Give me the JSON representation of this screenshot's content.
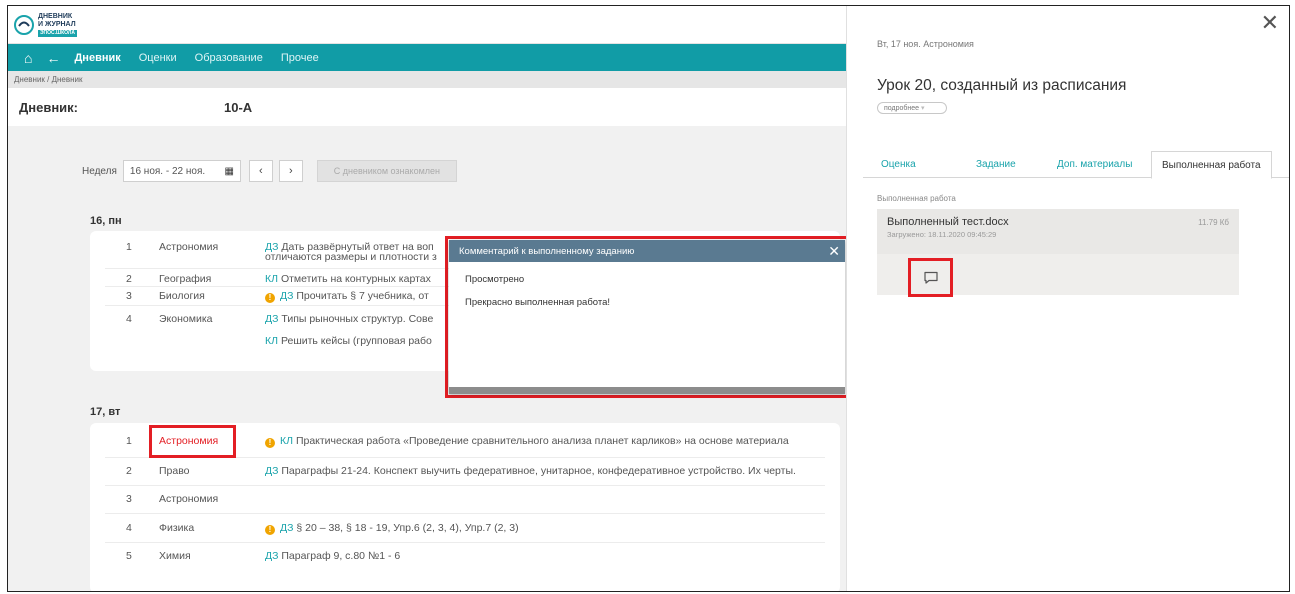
{
  "logo": {
    "line1": "ДНЕВНИК",
    "line2": "И ЖУРНАЛ",
    "tag": "ЭПОС.ШКОЛА"
  },
  "nav": {
    "home_icon": "home-icon",
    "back_icon": "back-arrow-icon",
    "items": [
      "Дневник",
      "Оценки",
      "Образование",
      "Прочее"
    ]
  },
  "breadcrumb": "Дневник / Дневник",
  "page": {
    "title": "Дневник:",
    "class": "10-А"
  },
  "week": {
    "label": "Неделя",
    "range": "16 ноя. - 22 ноя.",
    "prev": "‹",
    "next": "›",
    "ack_button": "С дневником ознакомлен"
  },
  "days": [
    {
      "label": "16, пн",
      "lessons": [
        {
          "num": "1",
          "subject": "Астрономия",
          "type": "ДЗ",
          "task": "Дать развёрнутый ответ на воп",
          "task2": "отличаются размеры и плотности з"
        },
        {
          "num": "2",
          "subject": "География",
          "type": "КЛ",
          "task": "Отметить на контурных картах"
        },
        {
          "num": "3",
          "subject": "Биология",
          "type": "ДЗ",
          "task": "Прочитать § 7 учебника, от"
        },
        {
          "num": "4",
          "subject": "Экономика",
          "type": "ДЗ",
          "task": "Типы рыночных структур. Сове",
          "type2": "КЛ",
          "task2": "Решить кейсы (групповая рабо"
        }
      ]
    },
    {
      "label": "17, вт",
      "lessons": [
        {
          "num": "1",
          "subject": "Астрономия",
          "type": "КЛ",
          "task": "Практическая работа «Проведение сравнительного анализа планет карликов» на основе материала"
        },
        {
          "num": "2",
          "subject": "Право",
          "type": "ДЗ",
          "task": "Параграфы 21-24. Конспект выучить федеративное, унитарное, конфедеративное устройство. Их черты."
        },
        {
          "num": "3",
          "subject": "Астрономия"
        },
        {
          "num": "4",
          "subject": "Физика",
          "type": "ДЗ",
          "task": "§ 20 – 38, § 18 - 19, Упр.6 (2, 3, 4), Упр.7 (2, 3)"
        },
        {
          "num": "5",
          "subject": "Химия",
          "type": "ДЗ",
          "task": "Параграф 9, с.80 №1 - 6"
        }
      ]
    }
  ],
  "modal": {
    "title": "Комментарий к выполненному заданию",
    "status": "Просмотрено",
    "comment": "Прекрасно выполненная работа!"
  },
  "panel": {
    "date": "Вт, 17 ноя. Астрономия",
    "title": "Урок 20, созданный из расписания",
    "more": "подробнее",
    "tabs": [
      "Оценка",
      "Задание",
      "Доп. материалы",
      "Выполненная работа"
    ],
    "section_label": "Выполненная работа",
    "file": {
      "name": "Выполненный тест.docx",
      "uploaded": "Загружено: 18.11.2020 09:45:29",
      "size": "11.79 Кб"
    }
  },
  "colors": {
    "accent": "#119ca6",
    "highlight": "#e31e24",
    "modal_header": "#5a7a91",
    "warning": "#f0a400"
  }
}
